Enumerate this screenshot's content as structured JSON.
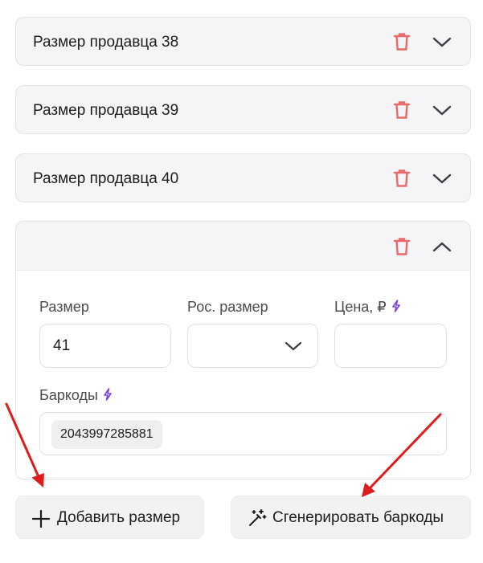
{
  "size_rows": [
    {
      "title": "Размер продавца 38"
    },
    {
      "title": "Размер продавца 39"
    },
    {
      "title": "Размер продавца 40"
    }
  ],
  "open_row": {
    "title": "",
    "size": {
      "label": "Размер",
      "value": "41"
    },
    "ros_size": {
      "label": "Рос. размер",
      "value": ""
    },
    "price": {
      "label": "Цена, ₽",
      "value": ""
    },
    "barcodes": {
      "label": "Баркоды",
      "items": [
        "2043997285881"
      ]
    }
  },
  "buttons": {
    "add_size": "Добавить размер",
    "generate_barcodes": "Сгенерировать баркоды"
  },
  "colors": {
    "trash": "#e9696a",
    "chevron": "#3c3c43",
    "bolt": "#7b3fe4",
    "arrow": "#e01b1b"
  },
  "icons": [
    "trash-icon",
    "chevron-down-icon",
    "chevron-up-icon",
    "bolt-icon",
    "plus-icon",
    "magic-wand-icon",
    "arrow-annotation"
  ]
}
